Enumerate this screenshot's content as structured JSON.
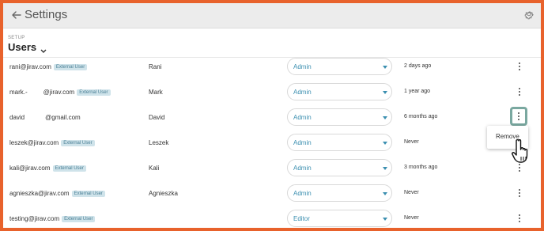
{
  "header": {
    "title": "Settings",
    "section_label": "SETUP",
    "page_title": "Users"
  },
  "users": [
    {
      "email_prefix": "rani@jirav.com",
      "email_suffix": "",
      "badge": "External User",
      "name": "Rani",
      "role": "Admin",
      "last_active": "2 days ago"
    },
    {
      "email_prefix": "mark.-",
      "email_suffix": "@jirav.com",
      "badge": "External User",
      "name": "Mark",
      "role": "Admin",
      "last_active": "1 year ago"
    },
    {
      "email_prefix": "david",
      "email_suffix": "@gmail.com",
      "badge": "",
      "name": "David",
      "role": "Admin",
      "last_active": "6 months ago"
    },
    {
      "email_prefix": "leszek@jirav.com",
      "email_suffix": "",
      "badge": "External User",
      "name": "Leszek",
      "role": "Admin",
      "last_active": "Never"
    },
    {
      "email_prefix": "kali@jirav.com",
      "email_suffix": "",
      "badge": "External User",
      "name": "Kali",
      "role": "Admin",
      "last_active": "3 months ago"
    },
    {
      "email_prefix": "agnieszka@jirav.com",
      "email_suffix": "",
      "badge": "External User",
      "name": "Agnieszka",
      "role": "Admin",
      "last_active": "Never"
    },
    {
      "email_prefix": "testing@jirav.com",
      "email_suffix": "",
      "badge": "External User",
      "name": "",
      "role": "Editor",
      "last_active": "Never"
    }
  ],
  "context_menu": {
    "items": [
      "Remove"
    ]
  },
  "colors": {
    "border": "#e8622c",
    "accent": "#3b8fb0",
    "badge_bg": "#cfe3ea"
  },
  "icons": {
    "back": "back-arrow-icon",
    "settings": "gear-icon",
    "row_menu": "more-vertical-icon",
    "pointer": "hand-pointer-icon"
  }
}
